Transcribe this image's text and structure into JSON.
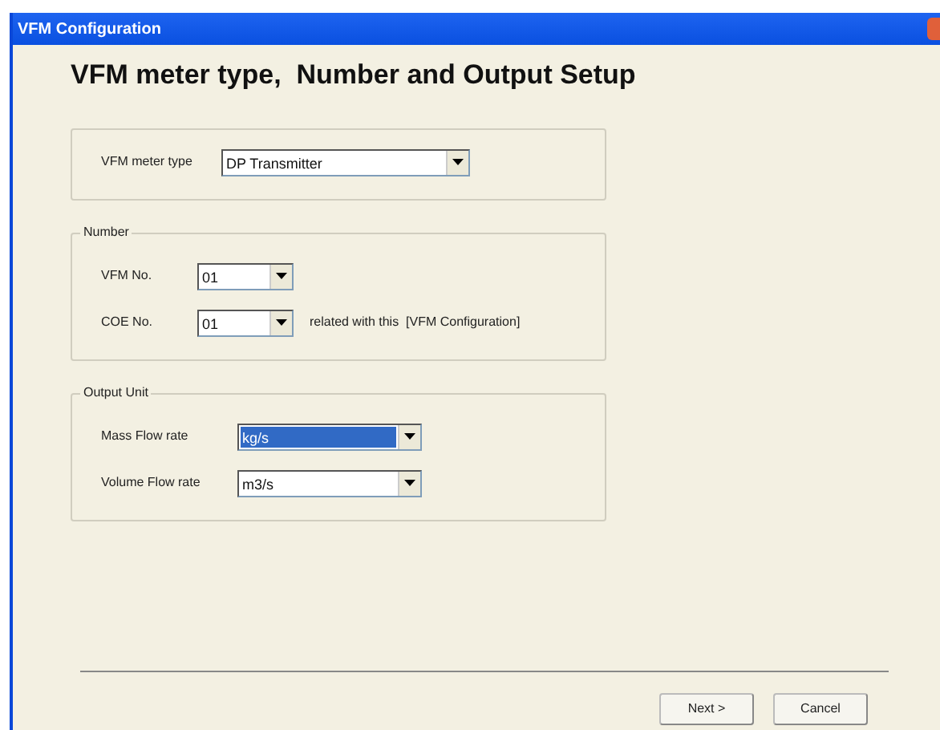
{
  "window": {
    "title": "VFM Configuration"
  },
  "heading": "VFM meter type,  Number and Output Setup",
  "groups": [
    {
      "fields": [
        {
          "label": "VFM meter type",
          "value": "DP Transmitter",
          "selected": false
        }
      ]
    },
    {
      "legend": "Number",
      "fields": [
        {
          "label": "VFM No.",
          "value": "01",
          "selected": false
        },
        {
          "label": "COE No.",
          "value": "01",
          "selected": false,
          "note": "related with this  [VFM Configuration]"
        }
      ]
    },
    {
      "legend": "Output Unit",
      "fields": [
        {
          "label": "Mass Flow rate",
          "value": "kg/s",
          "selected": true
        },
        {
          "label": "Volume Flow rate",
          "value": "m3/s",
          "selected": false
        }
      ]
    }
  ],
  "buttons": [
    "Next >",
    "Cancel"
  ]
}
